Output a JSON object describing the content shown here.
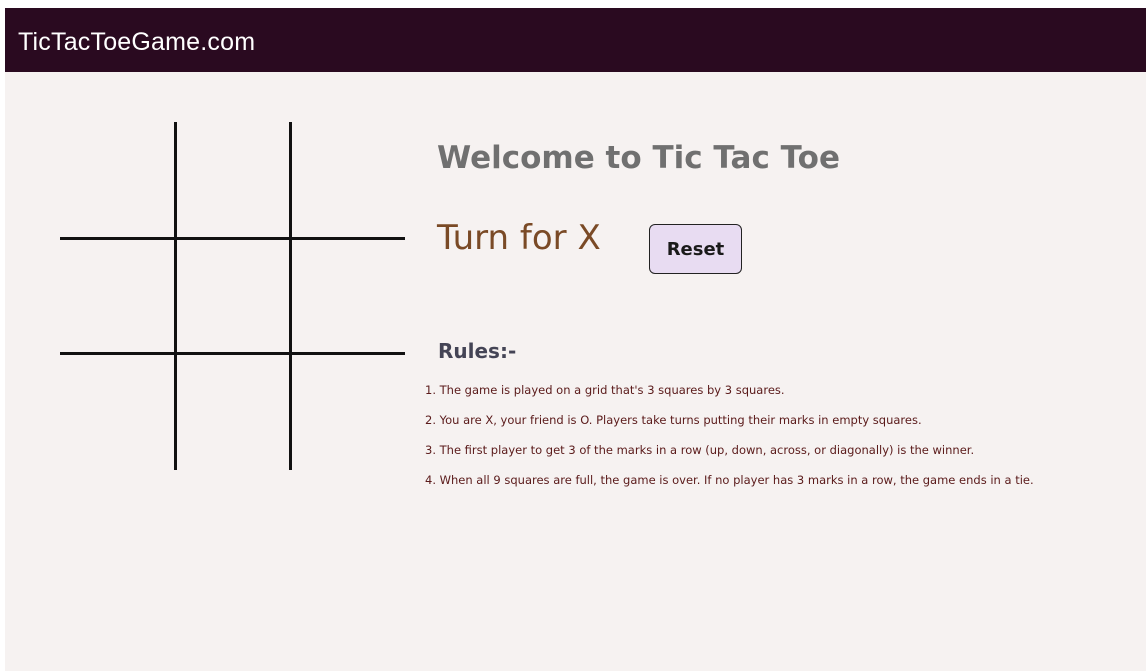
{
  "header": {
    "brand": "TicTacToeGame.com"
  },
  "board": {
    "cells": [
      "",
      "",
      "",
      "",
      "",
      "",
      "",
      "",
      ""
    ]
  },
  "info": {
    "welcome": "Welcome to Tic Tac Toe",
    "turn": "Turn for X",
    "reset_label": "Reset",
    "rules_title": "Rules:-",
    "rules": [
      "1. The game is played on a grid that's 3 squares by 3 squares.",
      "2. You are X, your friend is O. Players take turns putting their marks in empty squares.",
      "3. The first player to get 3 of the marks in a row (up, down, across, or diagonally) is the winner.",
      "4. When all 9 squares are full, the game is over. If no player has 3 marks in a row, the game ends in a tie."
    ]
  },
  "colors": {
    "navbar": "#2a0a20",
    "page_background": "#f6f2f1",
    "welcome_text": "#707070",
    "turn_text": "#7a4a26",
    "reset_button": "#e8dcf2",
    "rules_text": "#5a1a1a"
  }
}
